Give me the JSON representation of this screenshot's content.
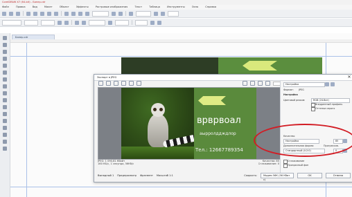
{
  "window": {
    "title": "CorelDRAW X7 (64-bit) - Банер.cdr",
    "menu": [
      "Файл",
      "Правка",
      "Вид",
      "Макет",
      "Объект",
      "Эффекты",
      "Растровые изображения",
      "Текст",
      "Таблица",
      "Инструменты",
      "Окно",
      "Справка"
    ]
  },
  "document": {
    "tab": "Банер.cdr"
  },
  "dialog": {
    "title": "Экспорт в JPEG",
    "close": "✕",
    "preview": {
      "headline": "врврвоал",
      "subline": "аырролддждлор",
      "phone": "Тел.: 12667789354"
    },
    "info_left": "JPEG: 1 090,81 Кбайт",
    "info_left2": "160 КБ/с, 1 секунда, 56Кб/с",
    "info_right": "Качество: 85",
    "info_right2": "Сглаживание: 0",
    "bottom_buttons": [
      "Выпадный 1",
      "Предпросмотр",
      "Фрагмент",
      "Масштаб 1:1"
    ],
    "speed_label": "Скорость:",
    "speed_value": "Модем 56К (56 Кбит с)",
    "ok": "OK",
    "cancel": "Отмена"
  },
  "panel": {
    "preset_label": "Настройка",
    "format_label": "Формат:",
    "format_value": "JPEG",
    "section": "Настройка",
    "color_mode_label": "Цветовой режим:",
    "color_mode_value": "RGB (24-бит)",
    "options": [
      "Внедренный профиль",
      "Оттенки серого"
    ],
    "quality_label": "Качество",
    "quality_select_value": "Настройка",
    "quality_number": "85",
    "subsample_label": "Дополнительная форма:",
    "subsample_value": "Стандартный (4:2:0)",
    "progressive_label": "Прогрессив.",
    "blur_value": "0",
    "transform_label": "Сглаживание",
    "transform_option": "Прозрачный фон"
  }
}
